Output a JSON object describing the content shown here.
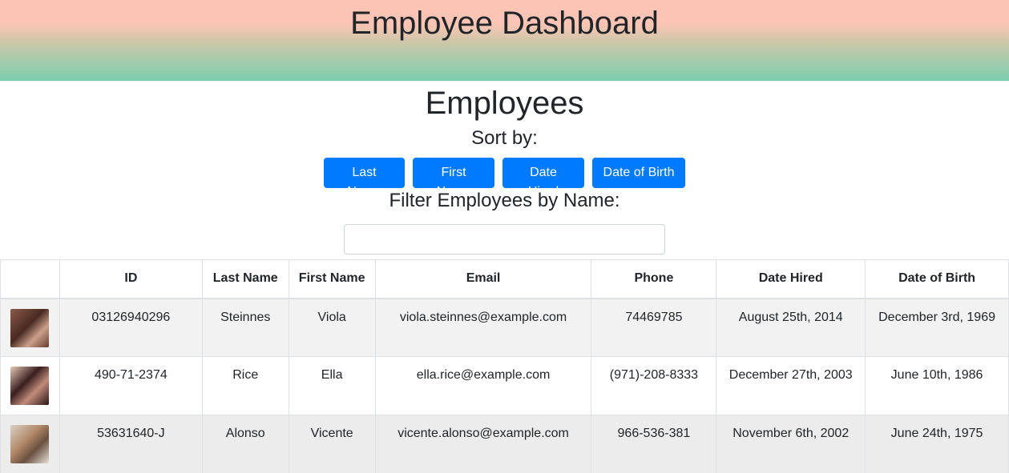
{
  "header": {
    "title": "Employee Dashboard"
  },
  "main": {
    "title": "Employees",
    "sort_label": "Sort by:",
    "sort_buttons": [
      "Last Name",
      "First Name",
      "Date Hired",
      "Date of Birth"
    ],
    "filter_label": "Filter Employees by Name:",
    "filter_value": "",
    "filter_placeholder": ""
  },
  "table": {
    "columns": [
      "",
      "ID",
      "Last Name",
      "First Name",
      "Email",
      "Phone",
      "Date Hired",
      "Date of Birth"
    ],
    "rows": [
      {
        "photo": "employee-photo-icon",
        "id": "03126940296",
        "last": "Steinnes",
        "first": "Viola",
        "email": "viola.steinnes@example.com",
        "phone": "74469785",
        "hired": "August 25th, 2014",
        "dob": "December 3rd, 1969"
      },
      {
        "photo": "employee-photo-icon",
        "id": "490-71-2374",
        "last": "Rice",
        "first": "Ella",
        "email": "ella.rice@example.com",
        "phone": "(971)-208-8333",
        "hired": "December 27th, 2003",
        "dob": "June 10th, 1986"
      },
      {
        "photo": "employee-photo-icon",
        "id": "53631640-J",
        "last": "Alonso",
        "first": "Vicente",
        "email": "vicente.alonso@example.com",
        "phone": "966-536-381",
        "hired": "November 6th, 2002",
        "dob": "June 24th, 1975"
      }
    ]
  },
  "colors": {
    "button": "#007bff",
    "header_top": "#fbc4b4",
    "header_bottom": "#7ccdb0"
  }
}
